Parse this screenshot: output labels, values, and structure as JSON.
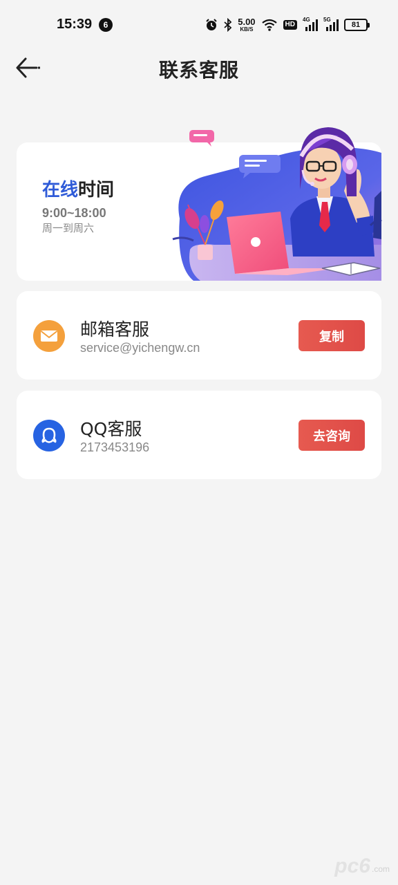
{
  "status_bar": {
    "time": "15:39",
    "notification_count": "6",
    "net_speed_value": "5.00",
    "net_speed_unit": "KB/S",
    "hd_label": "HD",
    "sim1_gen": "4G",
    "sim2_gen": "5G",
    "battery": "81"
  },
  "header": {
    "title": "联系客服"
  },
  "banner": {
    "title_highlight": "在线",
    "title_rest": "时间",
    "hours": "9:00~18:00",
    "days": "周一到周六"
  },
  "contacts": {
    "email": {
      "name": "邮箱客服",
      "value": "service@yichengw.cn",
      "button": "复制"
    },
    "qq": {
      "name": "QQ客服",
      "value": "2173453196",
      "button": "去咨询"
    }
  },
  "watermark": {
    "main": "pc6",
    "sub": ".com"
  },
  "colors": {
    "accent_blue": "#2f5bd8",
    "button_red": "#e0504a",
    "email_icon": "#f4a03c",
    "qq_icon": "#2763e2",
    "background": "#f4f4f4"
  }
}
